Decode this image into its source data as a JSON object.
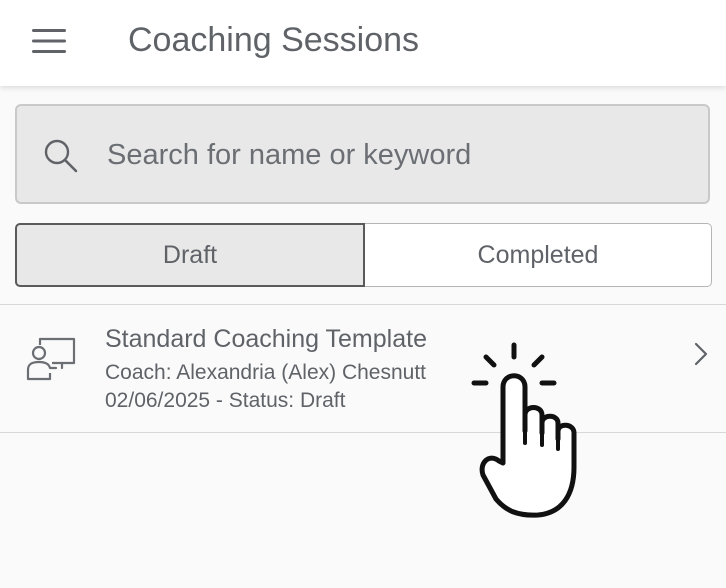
{
  "header": {
    "title": "Coaching Sessions",
    "menu_icon": "hamburger-menu-icon"
  },
  "search": {
    "icon": "search-icon",
    "placeholder": "Search for name or keyword",
    "value": ""
  },
  "segments": {
    "selected": "Draft",
    "items": [
      {
        "label": "Draft"
      },
      {
        "label": "Completed"
      }
    ]
  },
  "sessions": [
    {
      "icon": "presentation-coaching-icon",
      "title": "Standard Coaching Template",
      "coach": "Coach: Alexandria (Alex) Chesnutt",
      "meta": "02/06/2025 - Status: Draft"
    }
  ],
  "overlay": {
    "gesture_icon": "tap-hand-icon"
  },
  "colors": {
    "header_bg": "#ffffff",
    "page_bg": "#fafafa",
    "text": "#5f6368",
    "field_bg": "#e8e8e8",
    "selected_border": "#5a5a5a"
  }
}
